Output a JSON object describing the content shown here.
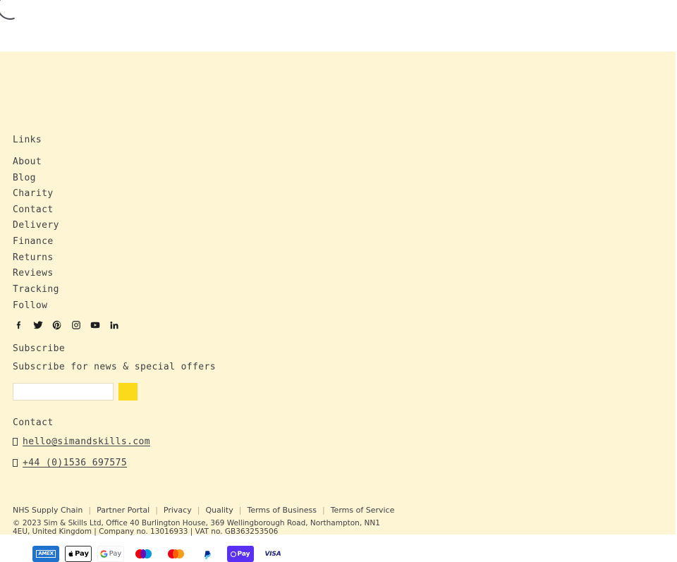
{
  "page": {
    "background_top": "#ffffff",
    "background_footer": "#fdf5d3",
    "accent": "#fada1b",
    "text_color": "#3f3f46"
  },
  "loader": {
    "name": "page-loading-spinner",
    "color": "#4b4b57"
  },
  "footer": {
    "links": {
      "heading": "Links",
      "items": [
        {
          "label": "About"
        },
        {
          "label": "Blog"
        },
        {
          "label": "Charity"
        },
        {
          "label": "Contact"
        },
        {
          "label": "Delivery"
        },
        {
          "label": "Finance"
        },
        {
          "label": "Returns"
        },
        {
          "label": "Reviews"
        },
        {
          "label": "Tracking"
        }
      ]
    },
    "follow": {
      "heading": "Follow",
      "items": [
        {
          "name": "facebook-icon",
          "label": "Facebook"
        },
        {
          "name": "twitter-icon",
          "label": "Twitter"
        },
        {
          "name": "pinterest-icon",
          "label": "Pinterest"
        },
        {
          "name": "instagram-icon",
          "label": "Instagram"
        },
        {
          "name": "youtube-icon",
          "label": "YouTube"
        },
        {
          "name": "linkedin-icon",
          "label": "LinkedIn"
        }
      ]
    },
    "subscribe": {
      "heading": "Subscribe",
      "description": "Subscribe for news & special offers",
      "input_value": "",
      "input_placeholder": "",
      "button_label": "",
      "button_color": "#fada1b"
    },
    "contact": {
      "heading": "Contact",
      "email": "hello@simandskills.com",
      "phone": "+44 (0)1536 697575"
    },
    "policy_links": [
      {
        "label": "NHS Supply Chain"
      },
      {
        "label": "Partner Portal"
      },
      {
        "label": "Privacy"
      },
      {
        "label": "Quality"
      },
      {
        "label": "Terms of Business"
      },
      {
        "label": "Terms of Service"
      }
    ],
    "policy_separator": "|",
    "copyright": "© 2023 Sim & Skills Ltd, Office 40 Burlington House, 369 Wellingborough Road, Northampton, NN1 4EU, United Kingdom | Company no. 13016933 | VAT no. GB363253506",
    "payments": [
      {
        "name": "amex-icon",
        "label": "AMEX"
      },
      {
        "name": "apple-pay-icon",
        "label": "Pay"
      },
      {
        "name": "google-pay-icon",
        "label": "Pay"
      },
      {
        "name": "maestro-icon",
        "label": "Maestro"
      },
      {
        "name": "mastercard-icon",
        "label": "Mastercard"
      },
      {
        "name": "paypal-icon",
        "label": "PayPal"
      },
      {
        "name": "shop-pay-icon",
        "label": "Pay"
      },
      {
        "name": "visa-icon",
        "label": "VISA"
      }
    ]
  }
}
